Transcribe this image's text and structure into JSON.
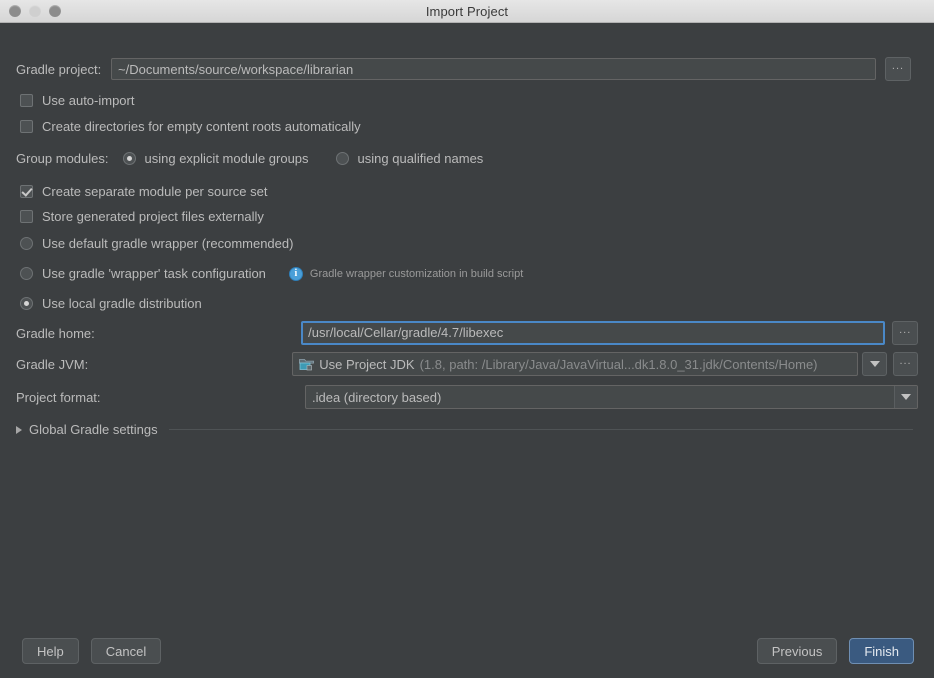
{
  "window": {
    "title": "Import Project",
    "traffic_lights": [
      "close-button",
      "minimize-button",
      "zoom-button"
    ]
  },
  "form": {
    "gradle_project": {
      "label": "Gradle project:",
      "value": "~/Documents/source/workspace/librarian",
      "browse_label": "..."
    },
    "use_auto_import": {
      "label": "Use auto-import",
      "checked": false
    },
    "create_directories": {
      "label": "Create directories for empty content roots automatically",
      "checked": false
    },
    "group_modules": {
      "label": "Group modules:",
      "options": [
        {
          "label": "using explicit module groups",
          "selected": true
        },
        {
          "label": "using qualified names",
          "selected": false
        }
      ]
    },
    "create_separate_module": {
      "label": "Create separate module per source set",
      "checked": true
    },
    "store_generated_externally": {
      "label": "Store generated project files externally",
      "checked": false
    },
    "distribution": {
      "options": [
        {
          "label": "Use default gradle wrapper (recommended)",
          "selected": false
        },
        {
          "label": "Use gradle 'wrapper' task configuration",
          "selected": false
        },
        {
          "label": "Use local gradle distribution",
          "selected": true
        }
      ],
      "hint": "Gradle wrapper customization in build script"
    },
    "gradle_home": {
      "label": "Gradle home:",
      "value": "/usr/local/Cellar/gradle/4.7/libexec",
      "browse_label": "...",
      "focused": true
    },
    "gradle_jvm": {
      "label": "Gradle JVM:",
      "value": "Use Project JDK",
      "detail": "(1.8, path: /Library/Java/JavaVirtual...dk1.8.0_31.jdk/Contents/Home)",
      "browse_label": "..."
    },
    "project_format": {
      "label": "Project format:",
      "value": ".idea (directory based)"
    },
    "global_settings": {
      "label": "Global Gradle settings",
      "expanded": false
    }
  },
  "buttons": {
    "help": "Help",
    "cancel": "Cancel",
    "previous": "Previous",
    "finish": "Finish"
  },
  "colors": {
    "background": "#3c3f41",
    "field_background": "#45494a",
    "accent_focus": "#4a88c7",
    "default_button": "#3a5a80",
    "info_icon": "#4a9fd8",
    "jdk_icon": "#3d9bb5"
  }
}
